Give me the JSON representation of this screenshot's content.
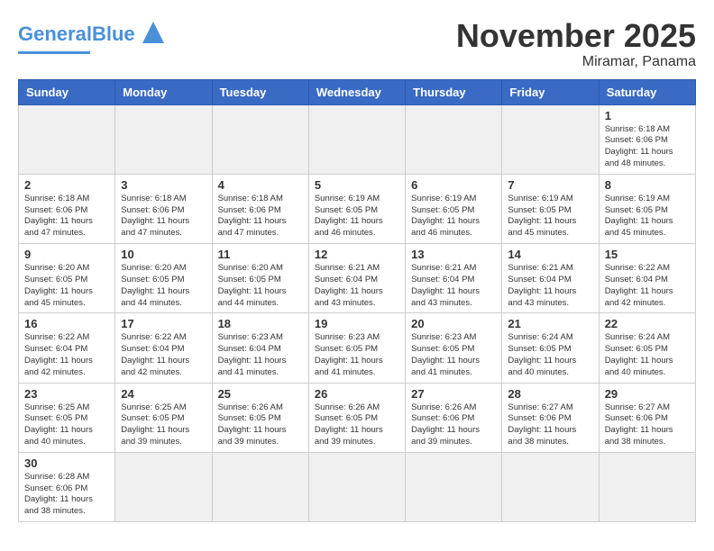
{
  "header": {
    "logo_general": "General",
    "logo_blue": "Blue",
    "title": "November 2025",
    "subtitle": "Miramar, Panama"
  },
  "days_of_week": [
    "Sunday",
    "Monday",
    "Tuesday",
    "Wednesday",
    "Thursday",
    "Friday",
    "Saturday"
  ],
  "weeks": [
    [
      {
        "day": "",
        "empty": true
      },
      {
        "day": "",
        "empty": true
      },
      {
        "day": "",
        "empty": true
      },
      {
        "day": "",
        "empty": true
      },
      {
        "day": "",
        "empty": true
      },
      {
        "day": "",
        "empty": true
      },
      {
        "day": "1",
        "sunrise": "6:18 AM",
        "sunset": "6:06 PM",
        "daylight": "11 hours and 48 minutes."
      }
    ],
    [
      {
        "day": "2",
        "sunrise": "6:18 AM",
        "sunset": "6:06 PM",
        "daylight": "11 hours and 47 minutes."
      },
      {
        "day": "3",
        "sunrise": "6:18 AM",
        "sunset": "6:06 PM",
        "daylight": "11 hours and 47 minutes."
      },
      {
        "day": "4",
        "sunrise": "6:18 AM",
        "sunset": "6:06 PM",
        "daylight": "11 hours and 47 minutes."
      },
      {
        "day": "5",
        "sunrise": "6:19 AM",
        "sunset": "6:05 PM",
        "daylight": "11 hours and 46 minutes."
      },
      {
        "day": "6",
        "sunrise": "6:19 AM",
        "sunset": "6:05 PM",
        "daylight": "11 hours and 46 minutes."
      },
      {
        "day": "7",
        "sunrise": "6:19 AM",
        "sunset": "6:05 PM",
        "daylight": "11 hours and 45 minutes."
      },
      {
        "day": "8",
        "sunrise": "6:19 AM",
        "sunset": "6:05 PM",
        "daylight": "11 hours and 45 minutes."
      }
    ],
    [
      {
        "day": "9",
        "sunrise": "6:20 AM",
        "sunset": "6:05 PM",
        "daylight": "11 hours and 45 minutes."
      },
      {
        "day": "10",
        "sunrise": "6:20 AM",
        "sunset": "6:05 PM",
        "daylight": "11 hours and 44 minutes."
      },
      {
        "day": "11",
        "sunrise": "6:20 AM",
        "sunset": "6:05 PM",
        "daylight": "11 hours and 44 minutes."
      },
      {
        "day": "12",
        "sunrise": "6:21 AM",
        "sunset": "6:04 PM",
        "daylight": "11 hours and 43 minutes."
      },
      {
        "day": "13",
        "sunrise": "6:21 AM",
        "sunset": "6:04 PM",
        "daylight": "11 hours and 43 minutes."
      },
      {
        "day": "14",
        "sunrise": "6:21 AM",
        "sunset": "6:04 PM",
        "daylight": "11 hours and 43 minutes."
      },
      {
        "day": "15",
        "sunrise": "6:22 AM",
        "sunset": "6:04 PM",
        "daylight": "11 hours and 42 minutes."
      }
    ],
    [
      {
        "day": "16",
        "sunrise": "6:22 AM",
        "sunset": "6:04 PM",
        "daylight": "11 hours and 42 minutes."
      },
      {
        "day": "17",
        "sunrise": "6:22 AM",
        "sunset": "6:04 PM",
        "daylight": "11 hours and 42 minutes."
      },
      {
        "day": "18",
        "sunrise": "6:23 AM",
        "sunset": "6:04 PM",
        "daylight": "11 hours and 41 minutes."
      },
      {
        "day": "19",
        "sunrise": "6:23 AM",
        "sunset": "6:05 PM",
        "daylight": "11 hours and 41 minutes."
      },
      {
        "day": "20",
        "sunrise": "6:23 AM",
        "sunset": "6:05 PM",
        "daylight": "11 hours and 41 minutes."
      },
      {
        "day": "21",
        "sunrise": "6:24 AM",
        "sunset": "6:05 PM",
        "daylight": "11 hours and 40 minutes."
      },
      {
        "day": "22",
        "sunrise": "6:24 AM",
        "sunset": "6:05 PM",
        "daylight": "11 hours and 40 minutes."
      }
    ],
    [
      {
        "day": "23",
        "sunrise": "6:25 AM",
        "sunset": "6:05 PM",
        "daylight": "11 hours and 40 minutes."
      },
      {
        "day": "24",
        "sunrise": "6:25 AM",
        "sunset": "6:05 PM",
        "daylight": "11 hours and 39 minutes."
      },
      {
        "day": "25",
        "sunrise": "6:26 AM",
        "sunset": "6:05 PM",
        "daylight": "11 hours and 39 minutes."
      },
      {
        "day": "26",
        "sunrise": "6:26 AM",
        "sunset": "6:05 PM",
        "daylight": "11 hours and 39 minutes."
      },
      {
        "day": "27",
        "sunrise": "6:26 AM",
        "sunset": "6:06 PM",
        "daylight": "11 hours and 39 minutes."
      },
      {
        "day": "28",
        "sunrise": "6:27 AM",
        "sunset": "6:06 PM",
        "daylight": "11 hours and 38 minutes."
      },
      {
        "day": "29",
        "sunrise": "6:27 AM",
        "sunset": "6:06 PM",
        "daylight": "11 hours and 38 minutes."
      }
    ],
    [
      {
        "day": "30",
        "sunrise": "6:28 AM",
        "sunset": "6:06 PM",
        "daylight": "11 hours and 38 minutes."
      },
      {
        "day": "",
        "empty": true
      },
      {
        "day": "",
        "empty": true
      },
      {
        "day": "",
        "empty": true
      },
      {
        "day": "",
        "empty": true
      },
      {
        "day": "",
        "empty": true
      },
      {
        "day": "",
        "empty": true
      }
    ]
  ]
}
